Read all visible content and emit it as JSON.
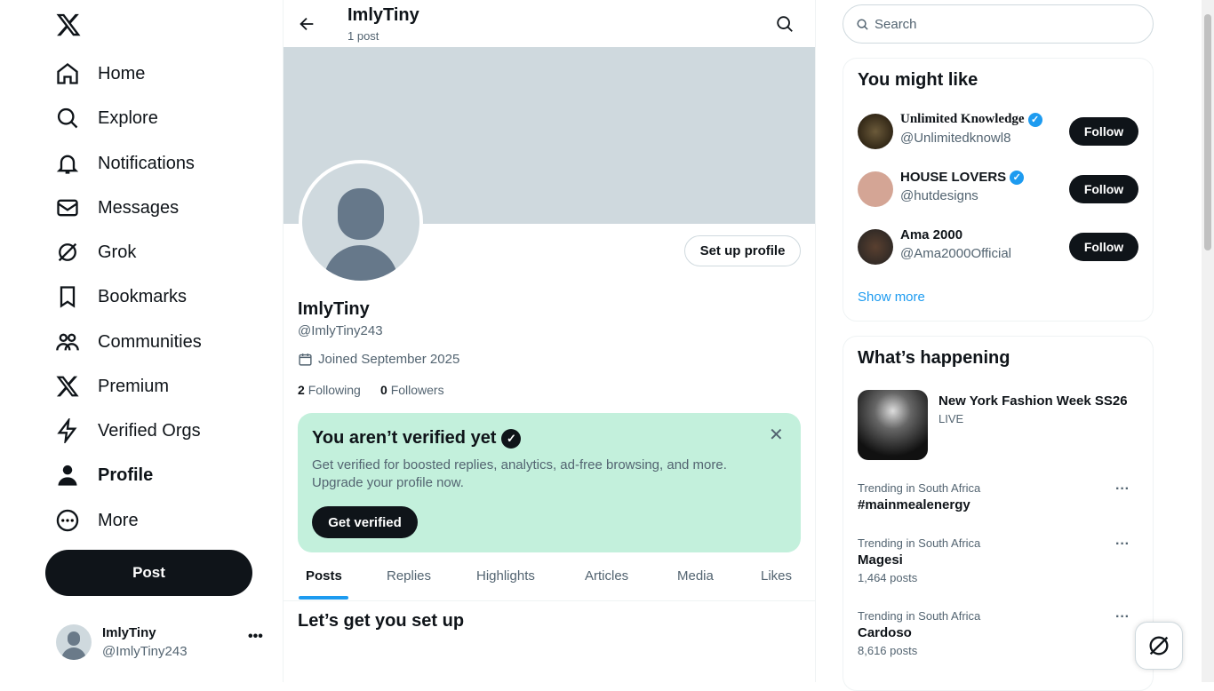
{
  "nav": {
    "items": [
      {
        "label": "Home",
        "icon": "home-icon"
      },
      {
        "label": "Explore",
        "icon": "search-icon"
      },
      {
        "label": "Notifications",
        "icon": "bell-icon"
      },
      {
        "label": "Messages",
        "icon": "mail-icon"
      },
      {
        "label": "Grok",
        "icon": "grok-icon"
      },
      {
        "label": "Bookmarks",
        "icon": "bookmark-icon"
      },
      {
        "label": "Communities",
        "icon": "communities-icon"
      },
      {
        "label": "Premium",
        "icon": "x-icon"
      },
      {
        "label": "Verified Orgs",
        "icon": "lightning-icon"
      },
      {
        "label": "Profile",
        "icon": "person-icon"
      },
      {
        "label": "More",
        "icon": "more-circle-icon"
      }
    ],
    "post_label": "Post",
    "account": {
      "name": "ImlyTiny",
      "handle": "@ImlyTiny243"
    }
  },
  "header": {
    "title": "ImlyTiny",
    "subtitle": "1 post"
  },
  "profile": {
    "setup_label": "Set up profile",
    "name": "ImlyTiny",
    "handle": "@ImlyTiny243",
    "joined": "Joined September 2025",
    "following_count": "2",
    "following_label": "Following",
    "followers_count": "0",
    "followers_label": "Followers",
    "banner_color": "#cfd9de"
  },
  "verify": {
    "title": "You aren’t verified yet",
    "body": "Get verified for boosted replies, analytics, ad-free browsing, and more. Upgrade your profile now.",
    "button": "Get verified",
    "bg": "#c3f0dc"
  },
  "tabs": [
    "Posts",
    "Replies",
    "Highlights",
    "Articles",
    "Media",
    "Likes"
  ],
  "setup_title": "Let’s get you set up",
  "search": {
    "placeholder": "Search"
  },
  "might_like": {
    "title": "You might like",
    "show_more": "Show more",
    "users": [
      {
        "name": "Unlimited Knowledge",
        "handle": "@Unlimitedknowl8",
        "verified": true,
        "follow": "Follow"
      },
      {
        "name": "HOUSE LOVERS",
        "handle": "@hutdesigns",
        "verified": true,
        "follow": "Follow"
      },
      {
        "name": "Ama 2000",
        "handle": "@Ama2000Official",
        "verified": false,
        "follow": "Follow"
      }
    ]
  },
  "happening": {
    "title": "What’s happening",
    "featured": {
      "title": "New York Fashion Week SS26",
      "status": "LIVE"
    },
    "trends": [
      {
        "context": "Trending in South Africa",
        "title": "#mainmealenergy",
        "posts": ""
      },
      {
        "context": "Trending in South Africa",
        "title": "Magesi",
        "posts": "1,464 posts"
      },
      {
        "context": "Trending in South Africa",
        "title": "Cardoso",
        "posts": "8,616 posts"
      }
    ]
  },
  "colors": {
    "accent": "#1d9bf0",
    "dark": "#0f1419"
  }
}
